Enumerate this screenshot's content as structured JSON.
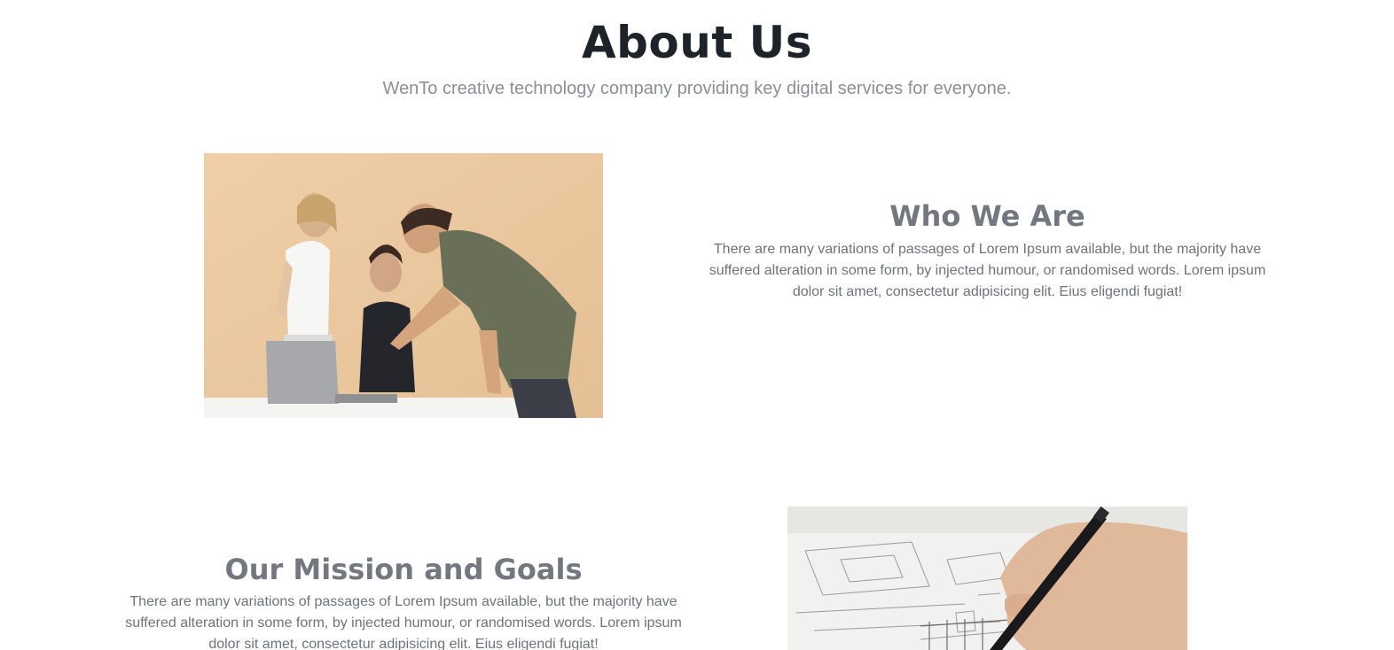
{
  "header": {
    "title": "About Us",
    "subtitle": "WenTo creative technology company providing key digital services for everyone."
  },
  "sections": [
    {
      "heading": "Who We Are",
      "text": "There are many variations of passages of Lorem Ipsum available, but the majority have suffered alteration in some form, by injected humour, or randomised words. Lorem ipsum dolor sit amet, consectetur adipisicing elit. Eius eligendi fugiat!",
      "image": "team-working-at-laptop-photo"
    },
    {
      "heading": "Our Mission and Goals",
      "text": "There are many variations of passages of Lorem Ipsum available, but the majority have suffered alteration in some form, by injected humour, or randomised words. Lorem ipsum dolor sit amet, consectetur adipisicing elit. Eius eligendi fugiat!",
      "image": "hand-drawing-sketch-photo"
    }
  ],
  "colors": {
    "title": "#1e2229",
    "subtitle": "#8a8f96",
    "heading": "#737880",
    "body_text": "#6e737a",
    "photo1_background": "#ecc9a2"
  }
}
